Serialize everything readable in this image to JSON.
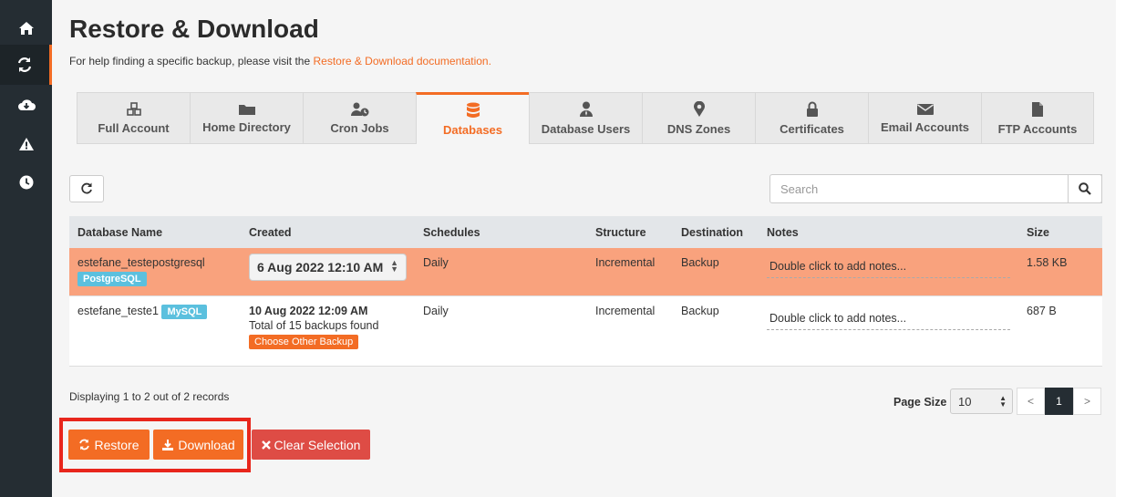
{
  "sidebar": {
    "items": [
      {
        "icon": "home-icon"
      },
      {
        "icon": "sync-icon",
        "active": true
      },
      {
        "icon": "cloud-download-icon"
      },
      {
        "icon": "warning-icon"
      },
      {
        "icon": "clock-icon"
      }
    ]
  },
  "page": {
    "title": "Restore & Download",
    "help_text": "For help finding a specific backup, please visit the ",
    "help_link": "Restore & Download documentation."
  },
  "tabs": [
    {
      "label": "Full Account",
      "icon": "cubes-icon"
    },
    {
      "label": "Home Directory",
      "icon": "folder-icon"
    },
    {
      "label": "Cron Jobs",
      "icon": "user-clock-icon"
    },
    {
      "label": "Databases",
      "icon": "database-icon",
      "active": true
    },
    {
      "label": "Database Users",
      "icon": "user-tie-icon"
    },
    {
      "label": "DNS Zones",
      "icon": "map-marker-icon"
    },
    {
      "label": "Certificates",
      "icon": "lock-icon"
    },
    {
      "label": "Email Accounts",
      "icon": "envelope-icon"
    },
    {
      "label": "FTP Accounts",
      "icon": "file-icon"
    }
  ],
  "search": {
    "placeholder": "Search"
  },
  "table": {
    "headers": [
      "Database Name",
      "Created",
      "Schedules",
      "Structure",
      "Destination",
      "Notes",
      "Size"
    ],
    "rows": [
      {
        "name": "estefane_testepostgresql",
        "badge": "PostgreSQL",
        "created": "6 Aug 2022 12:10 AM",
        "schedules": "Daily",
        "structure": "Incremental",
        "destination": "Backup",
        "notes": "Double click to add notes...",
        "size": "1.58 KB"
      },
      {
        "name": "estefane_teste1",
        "badge": "MySQL",
        "created": "10 Aug 2022 12:09 AM",
        "created_sub": "Total of 15 backups found",
        "choose_label": "Choose Other Backup",
        "schedules": "Daily",
        "structure": "Incremental",
        "destination": "Backup",
        "notes": "Double click to add notes...",
        "size": "687 B"
      }
    ]
  },
  "footer": {
    "displaying": "Displaying 1 to 2 out of 2 records",
    "page_size_label": "Page Size",
    "page_size_value": "10",
    "pager": {
      "prev": "<",
      "current": "1",
      "next": ">"
    }
  },
  "actions": {
    "restore": "Restore",
    "download": "Download",
    "clear": "Clear Selection"
  },
  "colors": {
    "accent": "#f36c24",
    "danger": "#de4c45",
    "sidebar": "#252d33",
    "selected_row": "#f9a27d",
    "badge": "#5bc0de"
  }
}
